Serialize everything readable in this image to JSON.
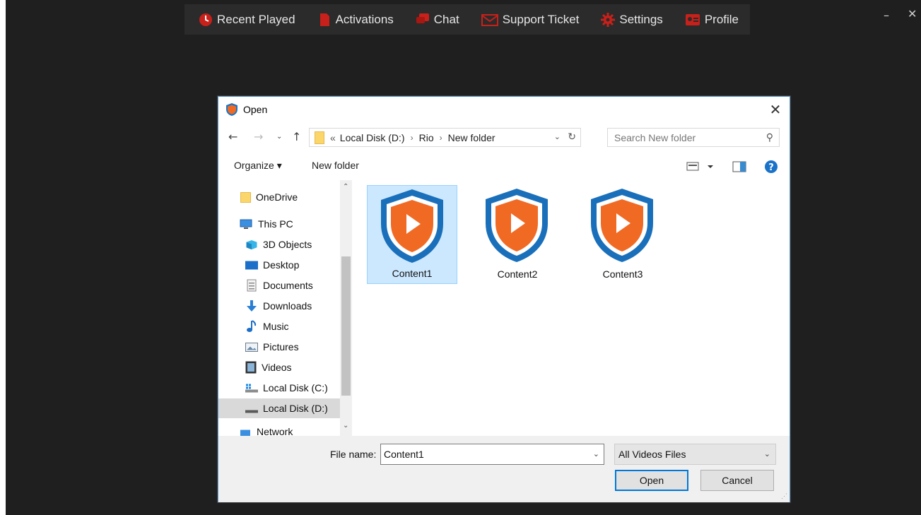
{
  "app": {
    "nav": [
      {
        "label": "Recent Played",
        "icon": "clock-icon"
      },
      {
        "label": "Activations",
        "icon": "document-icon"
      },
      {
        "label": "Chat",
        "icon": "chat-icon"
      },
      {
        "label": "Support Ticket",
        "icon": "mail-icon"
      },
      {
        "label": "Settings",
        "icon": "gear-icon"
      },
      {
        "label": "Profile",
        "icon": "id-card-icon"
      }
    ],
    "minimize": "–",
    "close": "✕",
    "accent": "#d9251c",
    "background": "#1f1f1f"
  },
  "dialog": {
    "title": "Open",
    "close": "✕",
    "address": {
      "prefix": "«",
      "crumbs": [
        "Local Disk (D:)",
        "Rio",
        "New folder"
      ]
    },
    "search_placeholder": "Search New folder",
    "toolbar": {
      "organize": "Organize ▾",
      "new_folder": "New folder"
    },
    "nav_pane": [
      {
        "label": "OneDrive",
        "icon": "folder-icon"
      },
      {
        "label": "This PC",
        "icon": "computer-icon"
      },
      {
        "label": "3D Objects",
        "icon": "cube-icon"
      },
      {
        "label": "Desktop",
        "icon": "desktop-icon"
      },
      {
        "label": "Documents",
        "icon": "documents-icon"
      },
      {
        "label": "Downloads",
        "icon": "download-icon"
      },
      {
        "label": "Music",
        "icon": "music-icon"
      },
      {
        "label": "Pictures",
        "icon": "pictures-icon"
      },
      {
        "label": "Videos",
        "icon": "videos-icon"
      },
      {
        "label": "Local Disk (C:)",
        "icon": "drive-icon"
      },
      {
        "label": "Local Disk (D:)",
        "icon": "drive-icon",
        "selected": true
      },
      {
        "label": "Network",
        "icon": "network-icon"
      }
    ],
    "files": [
      {
        "name": "Content1",
        "selected": true
      },
      {
        "name": "Content2"
      },
      {
        "name": "Content3"
      }
    ],
    "file_name_label": "File name:",
    "file_name_value": "Content1",
    "file_type": "All Videos Files",
    "open_label": "Open",
    "cancel_label": "Cancel"
  }
}
